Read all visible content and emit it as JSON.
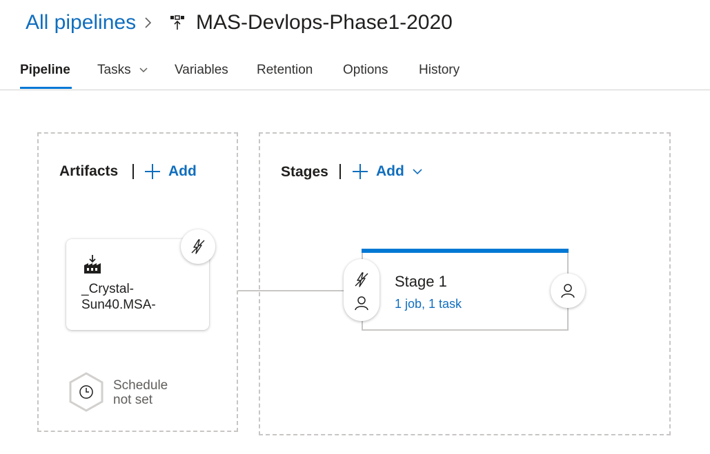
{
  "breadcrumb": {
    "root": "All pipelines",
    "title": "MAS-Devlops-Phase1-2020"
  },
  "tabs": [
    {
      "label": "Pipeline",
      "active": true
    },
    {
      "label": "Tasks",
      "has_dropdown": true
    },
    {
      "label": "Variables"
    },
    {
      "label": "Retention"
    },
    {
      "label": "Options"
    },
    {
      "label": "History"
    }
  ],
  "artifacts": {
    "title": "Artifacts",
    "add_label": "Add",
    "item": {
      "name_line1": "_Crystal-",
      "name_line2": "Sun40.MSA-"
    },
    "schedule_line1": "Schedule",
    "schedule_line2": "not set"
  },
  "stages": {
    "title": "Stages",
    "add_label": "Add",
    "stage": {
      "name": "Stage 1",
      "summary": "1 job, 1 task"
    }
  },
  "colors": {
    "accent": "#0078d4",
    "link": "#106ebe",
    "border": "#c8c6c4"
  }
}
